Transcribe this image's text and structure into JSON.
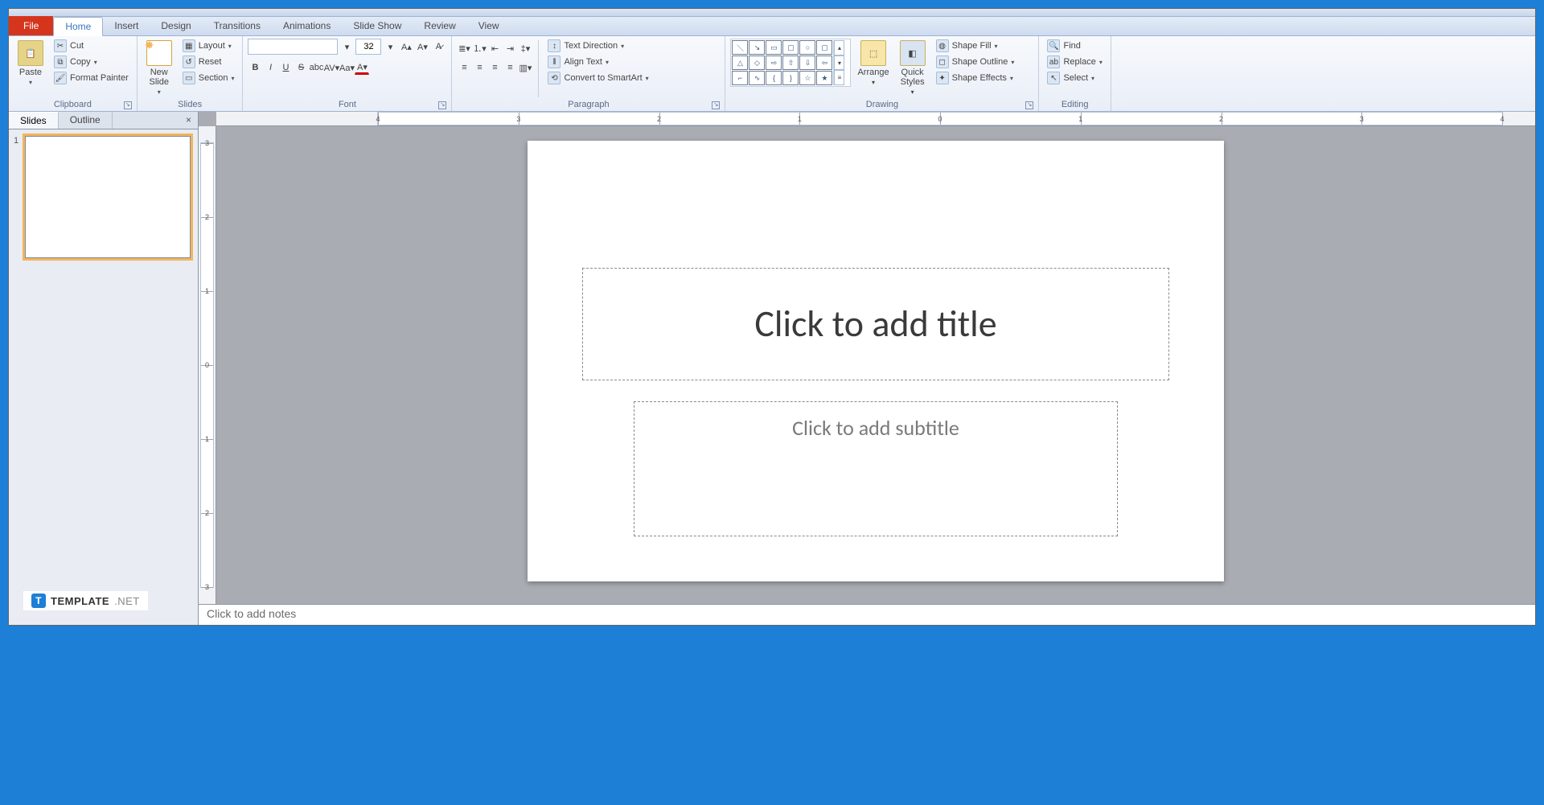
{
  "tabs": {
    "file": "File",
    "items": [
      "Home",
      "Insert",
      "Design",
      "Transitions",
      "Animations",
      "Slide Show",
      "Review",
      "View"
    ],
    "active": "Home"
  },
  "ribbon": {
    "clipboard": {
      "label": "Clipboard",
      "paste": "Paste",
      "cut": "Cut",
      "copy": "Copy",
      "format_painter": "Format Painter"
    },
    "slides": {
      "label": "Slides",
      "new_slide": "New\nSlide",
      "layout": "Layout",
      "reset": "Reset",
      "section": "Section"
    },
    "font": {
      "label": "Font",
      "size": "32",
      "name": ""
    },
    "paragraph": {
      "label": "Paragraph",
      "text_direction": "Text Direction",
      "align_text": "Align Text",
      "convert_smartart": "Convert to SmartArt"
    },
    "drawing": {
      "label": "Drawing",
      "arrange": "Arrange",
      "quick_styles": "Quick\nStyles",
      "shape_fill": "Shape Fill",
      "shape_outline": "Shape Outline",
      "shape_effects": "Shape Effects"
    },
    "editing": {
      "label": "Editing",
      "find": "Find",
      "replace": "Replace",
      "select": "Select"
    }
  },
  "slides_pane": {
    "tab_slides": "Slides",
    "tab_outline": "Outline",
    "slide_number": "1"
  },
  "ruler": {
    "h_labels": [
      "4",
      "3",
      "2",
      "1",
      "0",
      "1",
      "2",
      "3",
      "4"
    ],
    "v_labels": [
      "3",
      "2",
      "1",
      "0",
      "1",
      "2",
      "3"
    ]
  },
  "slide": {
    "title_placeholder": "Click to add title",
    "subtitle_placeholder": "Click to add subtitle"
  },
  "notes": {
    "placeholder": "Click to add notes"
  },
  "watermark": {
    "brand": "TEMPLATE",
    "suffix": ".NET",
    "logo_letter": "T"
  }
}
